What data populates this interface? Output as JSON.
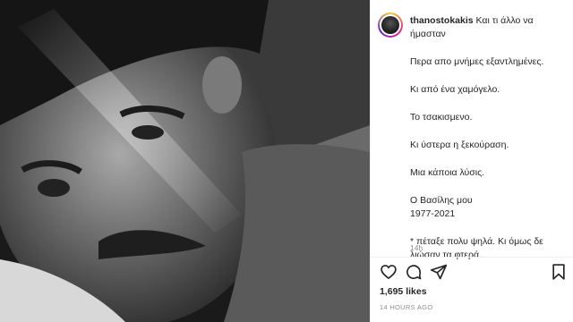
{
  "post": {
    "username": "thanostokakis",
    "caption_intro": "Και τι άλλο να ήμασταν",
    "lines": [
      "Περα απο μνήμες εξαντλημένες.",
      "Κι από ένα χαμόγελο.",
      "Το τσακισμενο.",
      "Κι ύστερα η ξεκούραση.",
      "Μια κάποια λύσις.",
      "Ο Βασίλης μου",
      "1977-2021",
      "* πέταξε πολυ ψηλά. Κι όμως δε λιώσαν τα φτερά."
    ],
    "comment_time": "14h",
    "likes": "1,695 likes",
    "posted_time": "14 HOURS AGO"
  },
  "icons": {
    "like": "heart-icon",
    "comment": "comment-icon",
    "share": "share-icon",
    "save": "bookmark-icon"
  },
  "colors": {
    "text": "#262626",
    "muted": "#8e8e8e",
    "divider": "#efefef"
  }
}
